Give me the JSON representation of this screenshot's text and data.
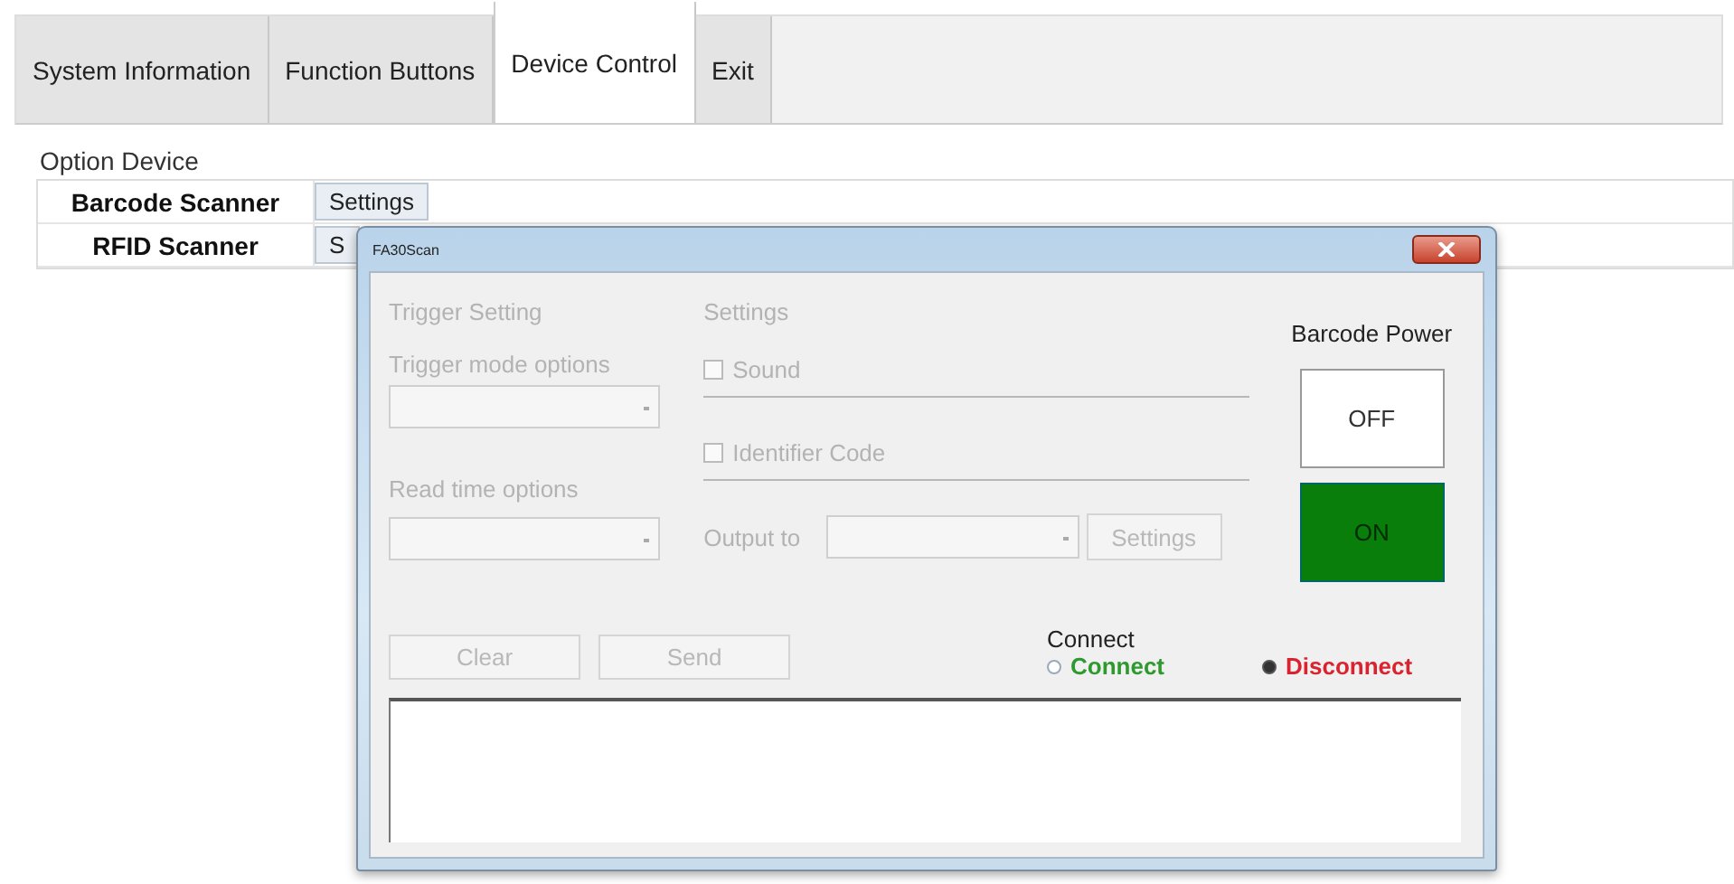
{
  "tabs": [
    {
      "label": "System Information",
      "selected": false
    },
    {
      "label": "Function Buttons",
      "selected": false
    },
    {
      "label": "Device Control",
      "selected": true
    },
    {
      "label": "Exit",
      "selected": false
    }
  ],
  "section_title": "Option Device",
  "devices": [
    {
      "name": "Barcode Scanner",
      "button": "Settings"
    },
    {
      "name": "RFID Scanner",
      "button": "S"
    }
  ],
  "dialog": {
    "title": "FA30Scan",
    "trigger": {
      "heading": "Trigger Setting",
      "mode_label": "Trigger mode options",
      "read_label": "Read time options",
      "disabled": true
    },
    "settings": {
      "heading": "Settings",
      "disabled": true,
      "options": [
        {
          "label": "Sound",
          "checked": false
        },
        {
          "label": "Identifier Code",
          "checked": false
        }
      ],
      "output_label": "Output to",
      "button": "Settings"
    },
    "power": {
      "heading": "Barcode Power",
      "buttons": [
        {
          "label": "OFF",
          "selected": false
        },
        {
          "label": "ON",
          "selected": true
        }
      ]
    },
    "actions": [
      {
        "label": "Clear",
        "disabled": true
      },
      {
        "label": "Send",
        "disabled": true
      }
    ],
    "connect": {
      "heading": "Connect",
      "options": [
        {
          "label": "Connect",
          "selected": false,
          "color": "#2e9a2e"
        },
        {
          "label": "Disconnect",
          "selected": true,
          "color": "#d9232e"
        }
      ]
    }
  }
}
